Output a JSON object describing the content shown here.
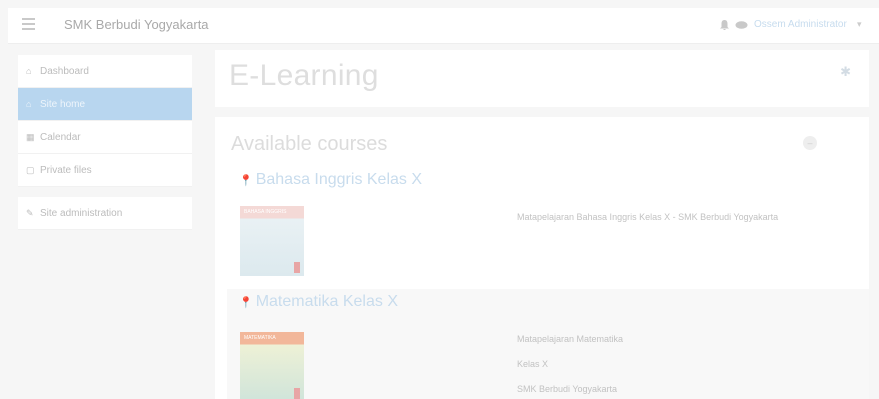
{
  "navbar": {
    "site_name": "SMK Berbudi Yogyakarta",
    "user_name": "Ossem Administrator",
    "user_caret": "▾",
    "icons": [
      "hamburger-icon",
      "bell-icon",
      "chat-icon"
    ]
  },
  "sidebar": {
    "items": [
      {
        "label": "Dashboard",
        "icon": "⌂",
        "icon_name": "dashboard-icon"
      },
      {
        "label": "Site home",
        "icon": "⌂",
        "icon_name": "home-icon"
      },
      {
        "label": "Calendar",
        "icon": "▦",
        "icon_name": "calendar-icon"
      },
      {
        "label": "Private files",
        "icon": "▢",
        "icon_name": "file-icon"
      },
      {
        "label": "Site administration",
        "icon": "✎",
        "icon_name": "wrench-icon"
      }
    ]
  },
  "header": {
    "title": "E-Learning",
    "gear": "✱"
  },
  "main": {
    "section_title": "Available courses",
    "collapse_icon": "–",
    "courses": [
      {
        "name": "Bahasa Inggris Kelas X",
        "pin": "📍",
        "thumb_band": "BAHASA INGGRIS",
        "summary": [
          "Matapelajaran Bahasa Inggris Kelas X - SMK Berbudi Yogyakarta"
        ]
      },
      {
        "name": "Matematika Kelas X",
        "pin": "📍",
        "thumb_band": "MATEMATIKA",
        "summary": [
          "Matapelajaran Matematika",
          "Kelas X",
          "SMK Berbudi Yogyakarta"
        ]
      }
    ]
  },
  "colors": {
    "accent": "#b8d6ef",
    "link": "#c8dced",
    "background": "#f6f6f6"
  }
}
